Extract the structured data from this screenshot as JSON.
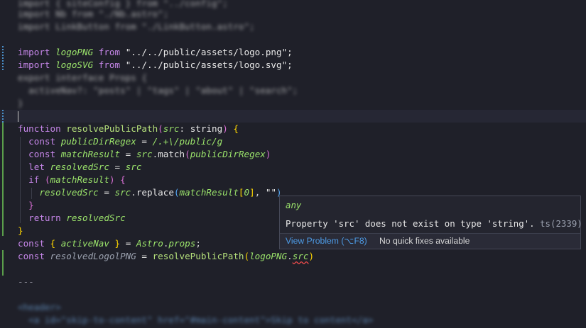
{
  "editor": {
    "blur_top": [
      "import { siteConfig } from \"../config\";",
      "import Nb from \"./Nb.astro\";",
      "import LinkButton from \"./LinkButton.astro\";"
    ],
    "import1": {
      "kw": "import",
      "name": "logoPNG",
      "from": "from",
      "path": "\"../../public/assets/logo.png\";"
    },
    "import2": {
      "kw": "import",
      "name": "logoSVG",
      "from": "from",
      "path": "\"../../public/assets/logo.svg\";"
    },
    "blur_mid": [
      "export interface Props {",
      "  activeNav?: \"posts\" | \"tags\" | \"about\" | \"search\";",
      "}"
    ],
    "fn_line": {
      "kw": "function",
      "name": "resolvePublicPath",
      "param": "src",
      "type": "string"
    },
    "line_regex": {
      "kw": "const",
      "name": "publicDirRegex",
      "value": "/.+\\/public/g"
    },
    "line_match": {
      "kw": "const",
      "name": "matchResult",
      "obj": "src",
      "method": "match",
      "arg": "publicDirRegex"
    },
    "line_let": {
      "kw": "let",
      "name": "resolvedSrc",
      "value": "src"
    },
    "line_if": {
      "kw": "if",
      "cond": "matchResult"
    },
    "line_replace": {
      "name": "resolvedSrc",
      "obj": "src",
      "method": "replace",
      "arg1": "matchResult",
      "idx": "0",
      "arg2": "\"\""
    },
    "line_return": {
      "kw": "return",
      "name": "resolvedSrc"
    },
    "line_const_nav": {
      "kw": "const",
      "name": "activeNav",
      "obj": "Astro",
      "prop": "props"
    },
    "line_const_logo": {
      "kw": "const",
      "name": "resolvedLogolPNG",
      "fn": "resolvePublicPath",
      "arg": "logoPNG",
      "prop": "src"
    },
    "divider": "---",
    "blur_bottom": [
      "<header>",
      "  <a id=\"skip-to-content\" href=\"#main-content\">Skip to content</a>"
    ]
  },
  "hover": {
    "type": "any",
    "message": "Property 'src' does not exist on type 'string'.",
    "code": "ts(2339)",
    "view_problem": "View Problem (⌥F8)",
    "no_fixes": "No quick fixes available"
  },
  "colors": {
    "background": "#1f2029",
    "keyword": "#c586e8",
    "function": "#b5e07b",
    "variable": "#9be36b",
    "link": "#4d9be6",
    "error": "#f14c4c"
  }
}
